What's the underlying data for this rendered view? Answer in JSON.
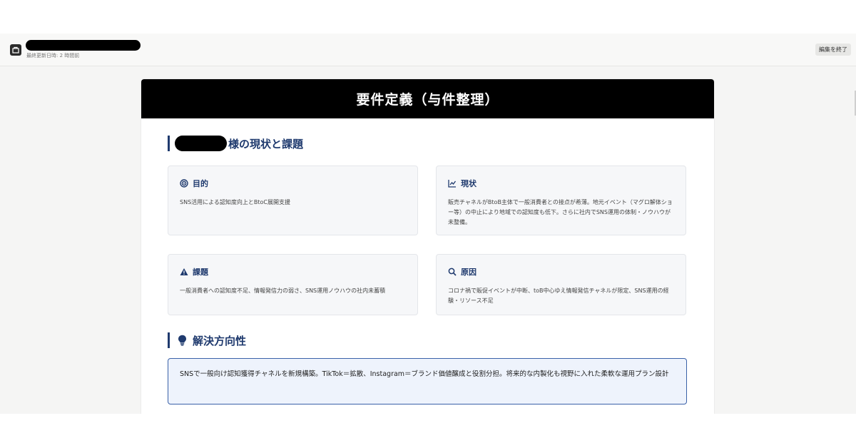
{
  "topbar": {
    "updated": "最終更新日時: 2 時間前",
    "end_button": "編集を終了"
  },
  "doc": {
    "title": "要件定義（与件整理）",
    "section1_title": "様の現状と課題",
    "cards": [
      {
        "icon": "target-icon",
        "title": "目的",
        "body": "SNS活用による認知度向上とBtoC展開支援"
      },
      {
        "icon": "chart-line-icon",
        "title": "現状",
        "body": "販売チャネルがBtoB主体で一般消費者との接点が希薄。地元イベント（マグロ解体ショー等）の中止により地域での認知度も低下。さらに社内でSNS運用の体制・ノウハウが未整備。"
      },
      {
        "icon": "warning-icon",
        "title": "課題",
        "body": "一般消費者への認知度不足、情報発信力の弱さ、SNS運用ノウハウの社内未蓄積"
      },
      {
        "icon": "search-icon",
        "title": "原因",
        "body": "コロナ禍で販促イベントが中断、toB中心ゆえ情報発信チャネルが限定、SNS運用の経験・リソース不足"
      }
    ],
    "section2_title": "解決方向性",
    "solution": "SNSで一般向け認知獲得チャネルを新規構築。TikTok＝拡散、Instagram＝ブランド価値醸成と役割分担。将来的な内製化も視野に入れた柔軟な運用プラン設計"
  }
}
